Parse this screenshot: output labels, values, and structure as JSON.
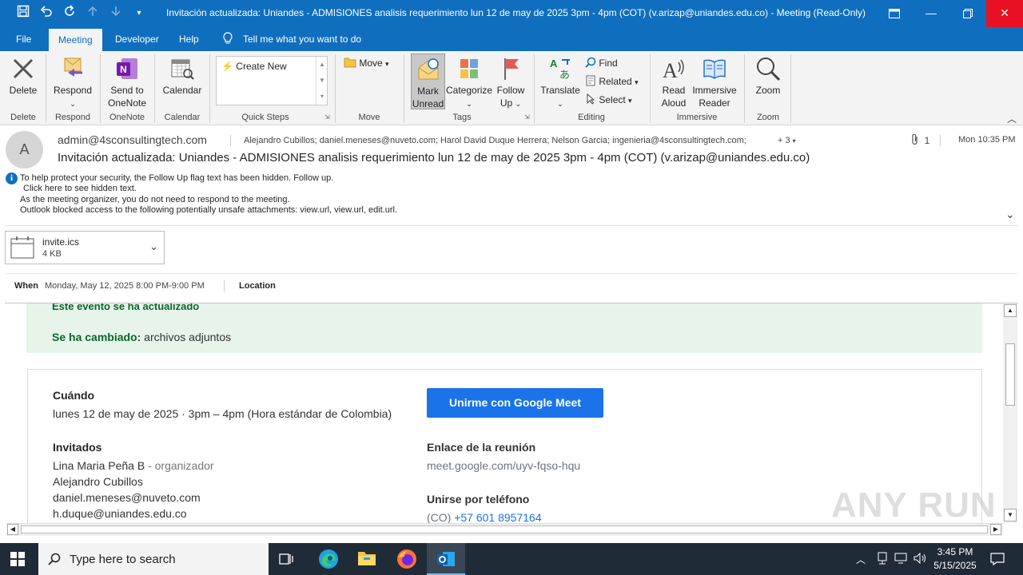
{
  "window": {
    "title": "Invitación actualizada: Uniandes - ADMISIONES analisis requerimiento lun 12 de may de 2025 3pm - 4pm (COT) (v.arizap@uniandes.edu.co)  -  Meeting  (Read-Only)",
    "qat_icons": [
      "save-icon",
      "undo-icon",
      "redo-icon",
      "up-arrow-icon",
      "down-arrow-icon",
      "customize-icon"
    ]
  },
  "tabs": {
    "file": "File",
    "meeting": "Meeting",
    "developer": "Developer",
    "help": "Help",
    "tell_me": "Tell me what you want to do"
  },
  "ribbon": {
    "delete": "Delete",
    "respond": "Respond",
    "send_to": "Send to",
    "onenote": "OneNote",
    "calendar": "Calendar",
    "create_new": "Create New",
    "move": "Move",
    "mark": "Mark",
    "unread": "Unread",
    "categorize": "Categorize",
    "follow": "Follow",
    "up": "Up",
    "translate": "Translate",
    "find": "Find",
    "related": "Related",
    "select": "Select",
    "read": "Read",
    "aloud": "Aloud",
    "immersive": "Immersive",
    "reader": "Reader",
    "zoom": "Zoom",
    "groups": {
      "delete": "Delete",
      "respond": "Respond",
      "onenote": "OneNote",
      "calendar": "Calendar",
      "quick_steps": "Quick Steps",
      "move": "Move",
      "tags": "Tags",
      "editing": "Editing",
      "immersive": "Immersive",
      "zoom": "Zoom"
    }
  },
  "message": {
    "avatar_letter": "A",
    "from": "admin@4sconsultingtech.com",
    "to": "Alejandro Cubillos; daniel.meneses@nuveto.com; Harol David Duque Herrera; Nelson Garcia; ingenieria@4sconsultingtech.com;",
    "more_recipients": "+ 3",
    "attachment_count": "1",
    "date": "Mon 10:35 PM",
    "subject": "Invitación actualizada: Uniandes - ADMISIONES analisis requerimiento lun 12 de may de 2025 3pm - 4pm (COT) (v.arizap@uniandes.edu.co)",
    "info_line1": "To help protect your security, the Follow Up flag text has been hidden. Follow up.",
    "info_line2": "Click here to see hidden text.",
    "info_line3": "As the meeting organizer, you do not need to respond to the meeting.",
    "info_line4": "Outlook blocked access to the following potentially unsafe attachments: view.url, view.url, edit.url.",
    "attachment_name": "invite.ics",
    "attachment_size": "4 KB",
    "when_label": "When",
    "when_value": "Monday, May 12, 2025 8:00 PM-9:00 PM",
    "location_label": "Location"
  },
  "body": {
    "updated_title": "Este evento se ha actualizado",
    "changed_label": "Se ha cambiado:",
    "changed_value": "archivos adjuntos",
    "when_label": "Cuándo",
    "when_value": "lunes 12 de may de 2025 · 3pm – 4pm (Hora estándar de Colombia)",
    "meet_button": "Unirme con Google Meet",
    "guests_label": "Invitados",
    "guest1": "Lina Maria Peña B",
    "guest1_role": "- organizador",
    "guest2": "Alejandro Cubillos",
    "guest3": "daniel.meneses@nuveto.com",
    "guest4": "h.duque@uniandes.edu.co",
    "link_label": "Enlace de la reunión",
    "link_value": "meet.google.com/uyv-fqso-hqu",
    "phone_label": "Unirse por teléfono",
    "phone_country": "(CO)",
    "phone_number": "+57 601 8957164"
  },
  "taskbar": {
    "search_placeholder": "Type here to search",
    "time": "3:45 PM",
    "date": "5/15/2025"
  },
  "watermark": "ANY RUN",
  "colors": {
    "title_blue": "#106ebe",
    "meet_blue": "#1a73e8",
    "banner_green": "#e6f4ea",
    "green_text": "#0d652d"
  }
}
